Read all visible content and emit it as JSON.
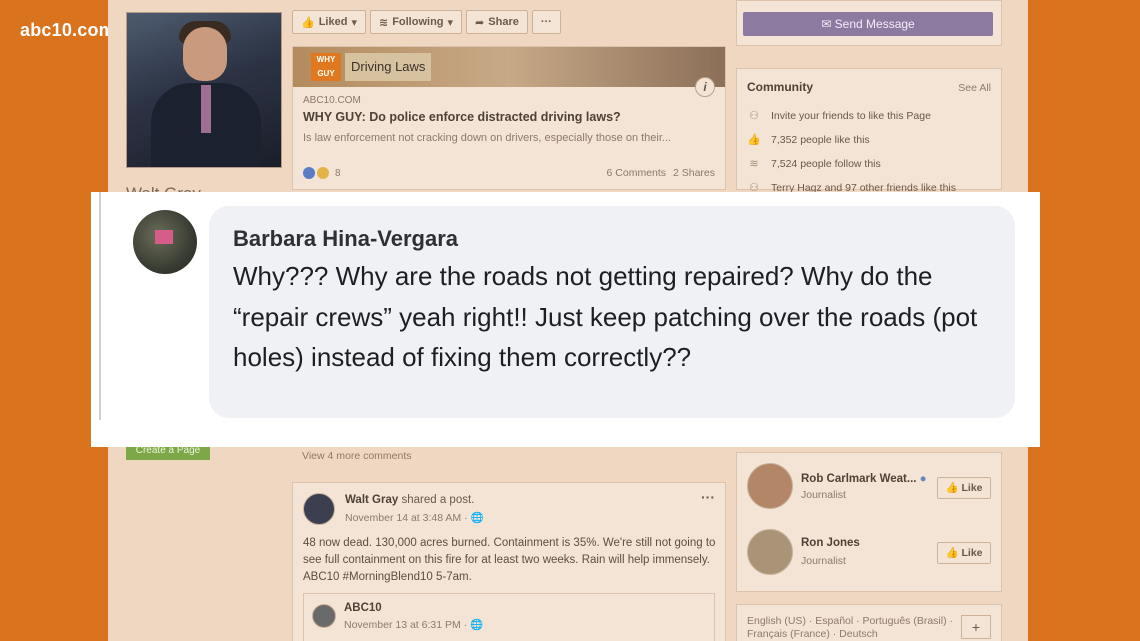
{
  "watermark": "abc10.com",
  "left": {
    "profile_name": "Walt Gray",
    "create_page": "Create a Page"
  },
  "action_bar": {
    "liked": "Liked",
    "following": "Following",
    "share": "Share",
    "more": "···"
  },
  "link_card": {
    "image_logo": "WHY GUY",
    "image_title": "Driving Laws",
    "info": "i",
    "domain": "ABC10.COM",
    "title": "WHY GUY: Do police enforce distracted driving laws?",
    "description": "Is law enforcement not cracking down on drivers, especially those on their...",
    "reaction_count": "8",
    "comments": "6 Comments",
    "shares": "2 Shares",
    "view_more": "View 4 more comments"
  },
  "post": {
    "author": "Walt Gray",
    "action": "shared a post.",
    "time": "November 14 at 3:48 AM · ",
    "dots": "···",
    "body": "48 now dead. 130,000 acres burned. Containment is 35%. We're still not going to see full containment on this fire for at least two weeks. Rain will help immensely. ABC10 #MorningBlend10 5-7am.",
    "shared_name": "ABC10",
    "shared_time": "November 13 at 6:31 PM · "
  },
  "right": {
    "send_message": "Send Message",
    "community_title": "Community",
    "see_all": "See All",
    "community_rows": [
      {
        "icon": "invite-icon",
        "glyph": "⚇",
        "text": "Invite your friends to like this Page"
      },
      {
        "icon": "thumbs-up-icon",
        "glyph": "👍",
        "text": "7,352 people like this"
      },
      {
        "icon": "rss-icon",
        "glyph": "≋",
        "text": "7,524 people follow this"
      },
      {
        "icon": "friends-icon",
        "glyph": "⚇",
        "text": "Terry Hagz and 97 other friends like this"
      }
    ],
    "people": [
      {
        "name": "Rob Carlmark Weat...",
        "role": "Journalist",
        "like": "Like"
      },
      {
        "name": "Ron Jones",
        "role": "Journalist",
        "like": "Like"
      }
    ],
    "languages": "English (US) · Español · Português (Brasil) · Français (France) · Deutsch",
    "add_language": "+"
  },
  "comment": {
    "name": "Barbara Hina-Vergara",
    "text": "Why??? Why are the roads not getting repaired? Why do the “repair crews” yeah right!! Just keep patching over the roads (pot holes) instead of fixing them correctly??"
  },
  "colors": {
    "background": "#d9731e",
    "send_message": "#8c7aa1",
    "create_page": "#7ea848"
  }
}
